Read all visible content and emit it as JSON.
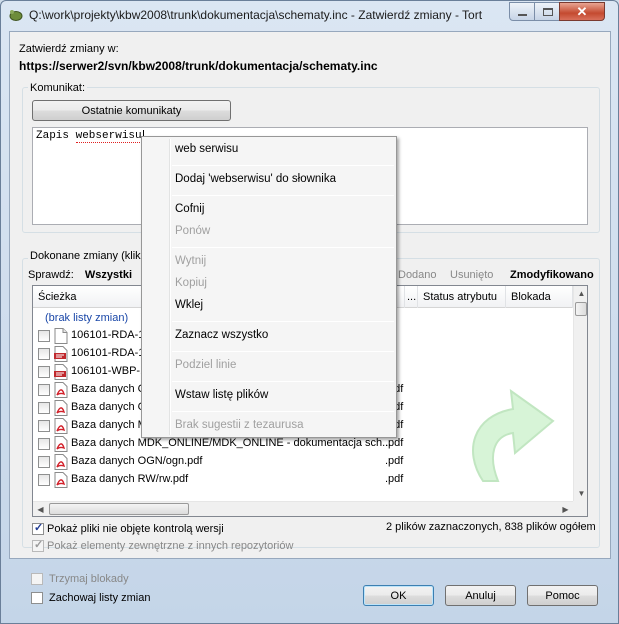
{
  "window": {
    "title": "Q:\\work\\projekty\\kbw2008\\trunk\\dokumentacja\\schematy.inc - Zatwierdź zmiany - Tort",
    "close_glyph": "✕"
  },
  "commit": {
    "to_label": "Zatwierdź zmiany w:",
    "url": "https://serwer2/svn/kbw2008/trunk/dokumentacja/schematy.inc"
  },
  "message": {
    "group_label": "Komunikat:",
    "recent_button": "Ostatnie komunikaty",
    "text_plain": "Zapis ",
    "text_misspelled": "webserwisu"
  },
  "changes": {
    "group_label": "Dokonane zmiany (klikni",
    "filter_label": "Sprawdź:",
    "filters": {
      "all": "Wszystki",
      "added": "Dodano",
      "unversioned": "Usunięto",
      "modified": "Zmodyfikowano"
    },
    "columns": {
      "path": "Ścieżka",
      "ext": "...",
      "prop_status": "Status atrybutu",
      "lock": "Blokada"
    },
    "unversioned_link": "(brak listy zmian)",
    "rows": [
      {
        "name": "106101-RDA-1",
        "ext": "",
        "icon": "text-file-icon"
      },
      {
        "name": "106101-RDA-1",
        "ext": "nl",
        "icon": "html-file-icon"
      },
      {
        "name": "106101-WBP-1",
        "ext": "nl",
        "icon": "html-file-icon"
      },
      {
        "name": "Baza danych C",
        "ext": ".pdf",
        "icon": "pdf-file-icon"
      },
      {
        "name": "Baza danych G",
        "ext": ".pdf",
        "icon": "pdf-file-icon"
      },
      {
        "name": "Baza danych M",
        "ext": ".pdf",
        "icon": "pdf-file-icon"
      },
      {
        "name": "Baza danych MDK_ONLINE/MDK_ONLINE - dokumentacja sch...",
        "ext": ".pdf",
        "icon": "pdf-file-icon"
      },
      {
        "name": "Baza danych OGN/ogn.pdf",
        "ext": ".pdf",
        "icon": "pdf-file-icon"
      },
      {
        "name": "Baza danych RW/rw.pdf",
        "ext": ".pdf",
        "icon": "pdf-file-icon"
      }
    ],
    "show_unversioned": "Pokaż pliki nie objęte kontrolą wersji",
    "show_externals": "Pokaż elementy zewnętrzne z innych repozytoriów",
    "summary": "2 plików zaznaczonych, 838 plików ogółem"
  },
  "bottom": {
    "keep_locks": "Trzymaj blokady",
    "keep_changelists": "Zachowaj listy zmian",
    "ok": "OK",
    "cancel": "Anuluj",
    "help": "Pomoc"
  },
  "context_menu": {
    "suggestion": "web serwisu",
    "add_to_dict": "Dodaj 'webserwisu' do słownika",
    "undo": "Cofnij",
    "redo": "Ponów",
    "cut": "Wytnij",
    "copy": "Kopiuj",
    "paste": "Wklej",
    "select_all": "Zaznacz wszystko",
    "split_lines": "Podziel linie",
    "paste_filelist": "Wstaw listę plików",
    "no_thesaurus": "Brak sugestii z tezaurusa"
  }
}
